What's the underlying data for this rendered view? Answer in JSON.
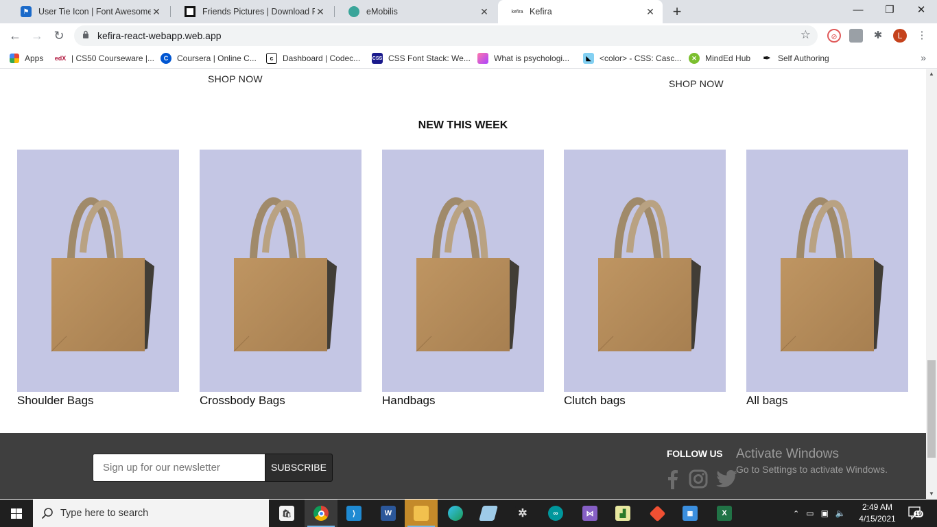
{
  "browser": {
    "tabs": [
      {
        "title": "User Tie Icon | Font Awesome",
        "active": false,
        "favicon_color": "#1b6ac9"
      },
      {
        "title": "Friends Pictures | Download Free",
        "active": false,
        "favicon_color": "#111111"
      },
      {
        "title": "eMobilis",
        "active": false,
        "favicon_color": "#3aa59a"
      },
      {
        "title": "Kefira",
        "active": true,
        "favicon_color": "#ffffff"
      }
    ],
    "new_tab_label": "+",
    "url": "kefira-react-webapp.web.app",
    "profile_initial": "L",
    "bookmarks": [
      {
        "label": "Apps",
        "icon": "apps-grid-icon"
      },
      {
        "label": "| CS50 Courseware |...",
        "icon": "edx-icon"
      },
      {
        "label": "Coursera | Online C...",
        "icon": "coursera-icon"
      },
      {
        "label": "Dashboard | Codec...",
        "icon": "codecademy-icon"
      },
      {
        "label": "CSS Font Stack: We...",
        "icon": "cssfontstack-icon"
      },
      {
        "label": "What is psychologi...",
        "icon": "psych-icon"
      },
      {
        "label": "<color> - CSS: Casc...",
        "icon": "mdn-icon"
      },
      {
        "label": "MindEd Hub",
        "icon": "minded-icon"
      },
      {
        "label": "Self Authoring",
        "icon": "pen-icon"
      }
    ],
    "bookmarks_more": "»"
  },
  "page": {
    "shop_now_left": "SHOP NOW",
    "shop_now_right": "SHOP NOW",
    "section_title": "NEW THIS WEEK",
    "products": [
      {
        "name": "Shoulder Bags"
      },
      {
        "name": "Crossbody Bags"
      },
      {
        "name": "Handbags"
      },
      {
        "name": "Clutch bags"
      },
      {
        "name": "All bags"
      }
    ],
    "footer": {
      "newsletter_placeholder": "Sign up for our newsletter",
      "subscribe_label": "SUBSCRIBE",
      "follow_us": "FOLLOW US",
      "watermark_title": "Activate Windows",
      "watermark_sub": "Go to Settings to activate Windows."
    }
  },
  "taskbar": {
    "search_placeholder": "Type here to search",
    "time": "2:49 AM",
    "date": "4/15/2021",
    "notification_count": "19"
  }
}
